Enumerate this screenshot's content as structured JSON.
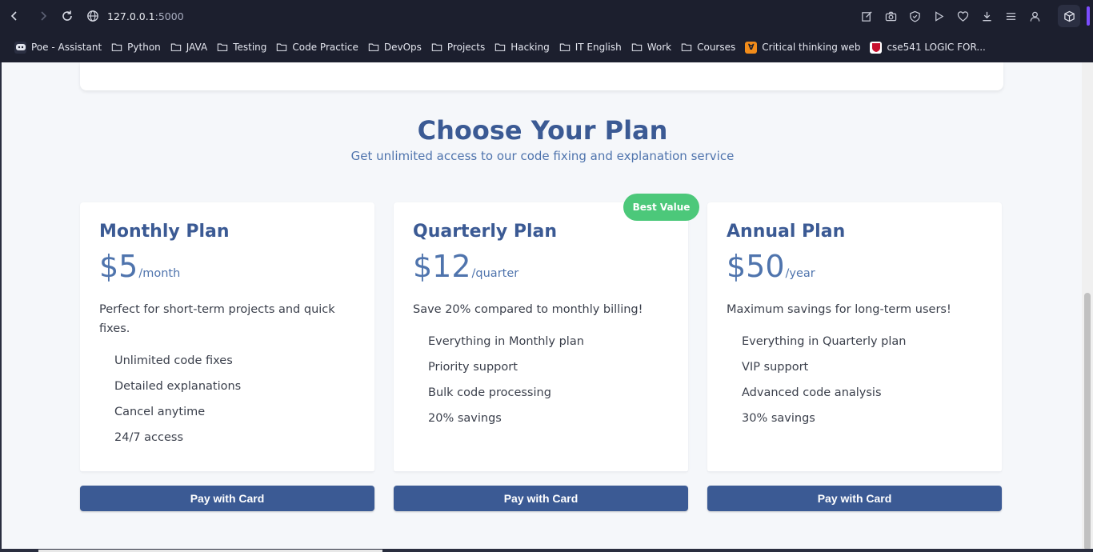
{
  "browser": {
    "url_host": "127.0.0.1",
    "url_port": ":5000",
    "bookmarks": [
      {
        "label": "Poe - Assistant",
        "icon": "poe-icon"
      },
      {
        "label": "Python",
        "icon": "folder-icon"
      },
      {
        "label": "JAVA",
        "icon": "folder-icon"
      },
      {
        "label": "Testing",
        "icon": "folder-icon"
      },
      {
        "label": "Code Practice",
        "icon": "folder-icon"
      },
      {
        "label": "DevOps",
        "icon": "folder-icon"
      },
      {
        "label": "Projects",
        "icon": "folder-icon"
      },
      {
        "label": "Hacking",
        "icon": "folder-icon"
      },
      {
        "label": "IT English",
        "icon": "folder-icon"
      },
      {
        "label": "Work",
        "icon": "folder-icon"
      },
      {
        "label": "Courses",
        "icon": "folder-icon"
      },
      {
        "label": "Critical thinking web",
        "icon": "critical-thinking-favicon"
      },
      {
        "label": "cse541 LOGIC FOR...",
        "icon": "cse541-favicon"
      }
    ]
  },
  "page": {
    "heading": "Choose Your Plan",
    "subheading": "Get unlimited access to our code fixing and explanation service",
    "badge": "Best Value",
    "plans": [
      {
        "name": "Monthly Plan",
        "amount": "$5",
        "period": "/month",
        "description": "Perfect for short-term projects and quick fixes.",
        "features": [
          "Unlimited code fixes",
          "Detailed explanations",
          "Cancel anytime",
          "24/7 access"
        ],
        "button": "Pay with Card"
      },
      {
        "name": "Quarterly Plan",
        "amount": "$12",
        "period": "/quarter",
        "description": "Save 20% compared to monthly billing!",
        "features": [
          "Everything in Monthly plan",
          "Priority support",
          "Bulk code processing",
          "20% savings"
        ],
        "button": "Pay with Card"
      },
      {
        "name": "Annual Plan",
        "amount": "$50",
        "period": "/year",
        "description": "Maximum savings for long-term users!",
        "features": [
          "Everything in Quarterly plan",
          "VIP support",
          "Advanced code analysis",
          "30% savings"
        ],
        "button": "Pay with Card"
      }
    ]
  },
  "colors": {
    "primary": "#3b5a94",
    "accent_text": "#4f74ad",
    "badge": "#4cc87a",
    "page_bg": "#f5f7fa",
    "chrome_bg": "#1c1f2e"
  }
}
